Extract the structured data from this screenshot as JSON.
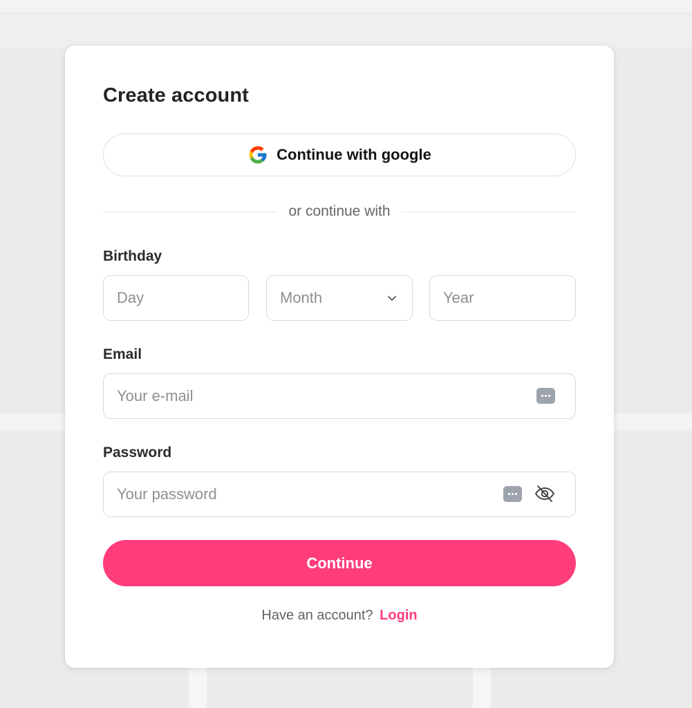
{
  "form": {
    "title": "Create account",
    "google_button_label": "Continue with google",
    "divider_text": "or continue with",
    "birthday": {
      "label": "Birthday",
      "day_placeholder": "Day",
      "month_placeholder": "Month",
      "year_placeholder": "Year"
    },
    "email": {
      "label": "Email",
      "placeholder": "Your e-mail"
    },
    "password": {
      "label": "Password",
      "placeholder": "Your password"
    },
    "continue_label": "Continue",
    "footer": {
      "prompt": "Have an account?",
      "login_label": "Login"
    }
  },
  "colors": {
    "accent": "#ff3d7b",
    "background": "#ebebeb",
    "card": "#ffffff"
  },
  "icons": [
    "google-icon",
    "chevron-down-icon",
    "keyboard-icon",
    "eye-off-icon"
  ]
}
